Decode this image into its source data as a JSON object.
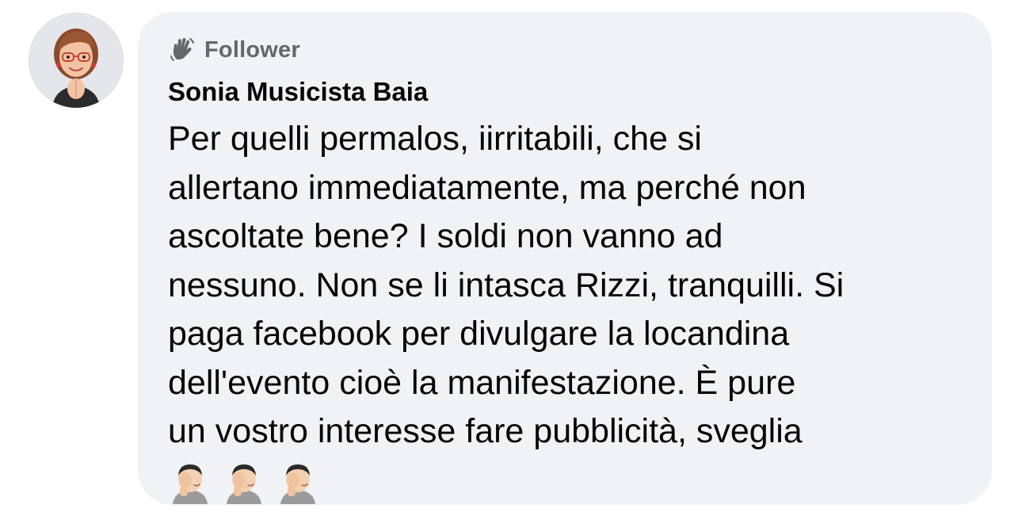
{
  "comment": {
    "badge": {
      "label": "Follower",
      "icon": "waving-hand-icon",
      "color": "#65676b"
    },
    "author": "Sonia Musicista Baia",
    "text": "Per quelli permalos, iirritabili, che si\nallertano immediatamente, ma perché non\nascoltate bene? I soldi non vanno ad\nnessuno. Non se li intasca Rizzi, tranquilli. Si\npaga facebook per divulgare la locandina\ndell'evento cioè la manifestazione. È pure\nun vostro interesse fare pubblicità, sveglia",
    "emojis": [
      "facepalm-emoji",
      "facepalm-emoji",
      "facepalm-emoji"
    ],
    "bubble_color": "#f0f2f5",
    "avatar": "memoji-avatar"
  }
}
